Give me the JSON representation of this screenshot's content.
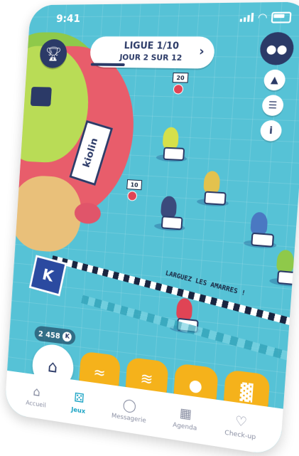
{
  "status_bar": {
    "time": "9:41"
  },
  "league": {
    "title": "LIGUE 1/10",
    "subtitle": "JOUR 2 SUR 12",
    "progress": 0.17
  },
  "map": {
    "banner_text": "kiolin",
    "start_line_text": "LARGUEZ LES AMARRES !",
    "k_flag": "K",
    "markers": [
      {
        "label": "20"
      },
      {
        "label": "10"
      }
    ]
  },
  "coins": {
    "value": "2 458",
    "unit": "K"
  },
  "icons": {
    "trophy": "trophy-icon",
    "group": "group-icon",
    "hat": "hat-icon",
    "book": "book-icon",
    "info": "info-icon",
    "shop": "shop-icon",
    "wind": "wind-icon",
    "bomb": "bomb-icon",
    "slot": "slot-machine-icon"
  },
  "bottom_nav": [
    {
      "label": "Accueil",
      "icon": "home-icon"
    },
    {
      "label": "Jeux",
      "icon": "dice-icon",
      "active": true
    },
    {
      "label": "Messagerie",
      "icon": "chat-icon"
    },
    {
      "label": "Agenda",
      "icon": "calendar-icon"
    },
    {
      "label": "Check-up",
      "icon": "heart-pulse-icon"
    }
  ],
  "colors": {
    "sea": "#56c2d6",
    "navy": "#2b3a67",
    "accent": "#f5b21b",
    "active_nav": "#1aa3c4"
  }
}
